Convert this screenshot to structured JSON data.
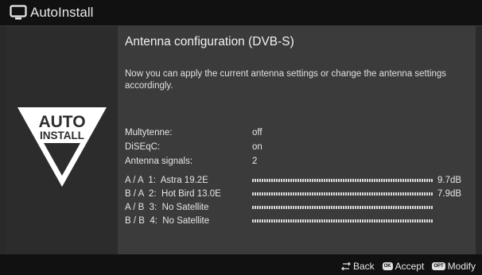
{
  "app": {
    "title": "AutoInstall",
    "icon": "tv-icon"
  },
  "logo": {
    "line1": "AUTO",
    "line2": "INSTALL"
  },
  "main": {
    "heading": "Antenna configuration (DVB-S)",
    "description": "Now you can apply the current antenna settings or change the antenna settings accordingly.",
    "settings": [
      {
        "label": "Multytenne:",
        "value": "off"
      },
      {
        "label": "DiSEqC:",
        "value": "on"
      },
      {
        "label": "Antenna signals:",
        "value": "2"
      }
    ],
    "signals": [
      {
        "label": "A / A  1:  Astra 19.2E",
        "level": 1.0,
        "value": "9.7dB"
      },
      {
        "label": "B / A  2:  Hot Bird 13.0E",
        "level": 1.0,
        "value": "7.9dB"
      },
      {
        "label": "A / B  3:  No Satellite",
        "level": 1.0,
        "value": ""
      },
      {
        "label": "B / B  4:  No Satellite",
        "level": 1.0,
        "value": ""
      }
    ]
  },
  "footer": {
    "back_label": "Back",
    "accept_key": "OK",
    "accept_label": "Accept",
    "modify_key": "OPT",
    "modify_label": "Modify"
  }
}
